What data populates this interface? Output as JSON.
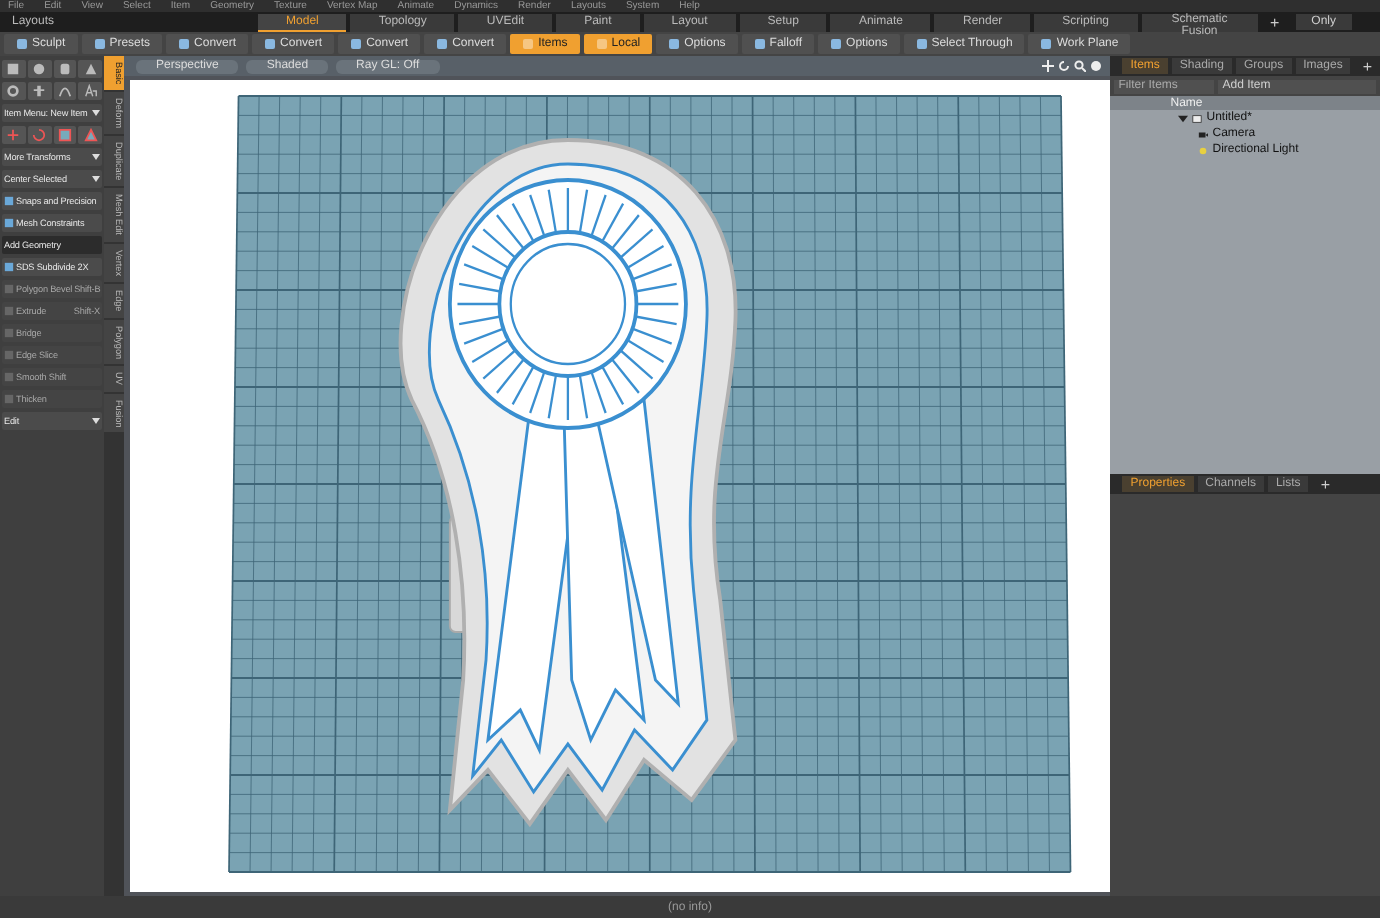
{
  "menu_bar": {
    "items": [
      "File",
      "Edit",
      "View",
      "Select",
      "Item",
      "Geometry",
      "Texture",
      "Vertex Map",
      "Animate",
      "Dynamics",
      "Render",
      "Layouts",
      "System",
      "Help"
    ]
  },
  "layout_bar": {
    "label": "Layouts",
    "tabs": [
      {
        "label": "Model",
        "selected": true
      },
      {
        "label": "Topology",
        "selected": false
      },
      {
        "label": "UVEdit",
        "selected": false
      },
      {
        "label": "Paint",
        "selected": false
      },
      {
        "label": "Layout",
        "selected": false
      },
      {
        "label": "Setup",
        "selected": false
      },
      {
        "label": "Animate",
        "selected": false
      },
      {
        "label": "Render",
        "selected": false
      },
      {
        "label": "Scripting",
        "selected": false
      },
      {
        "label": "Schematic Fusion",
        "selected": false
      }
    ],
    "add": "+",
    "only": "Only"
  },
  "toolbar": {
    "buttons": [
      {
        "label": "Sculpt",
        "selected": false
      },
      {
        "label": "Presets",
        "selected": false
      },
      {
        "label": "Convert",
        "selected": false
      },
      {
        "label": "Convert",
        "selected": false
      },
      {
        "label": "Convert",
        "selected": false
      },
      {
        "label": "Convert",
        "selected": false
      },
      {
        "label": "Items",
        "selected": true
      },
      {
        "label": "Local",
        "selected": true
      },
      {
        "label": "Options",
        "selected": false
      },
      {
        "label": "Falloff",
        "selected": false
      },
      {
        "label": "Options",
        "selected": false
      },
      {
        "label": "Select Through",
        "selected": false
      },
      {
        "label": "Work Plane",
        "selected": false
      }
    ]
  },
  "left_panel": {
    "items": [
      {
        "kind": "dropdown",
        "label": "Item Menu: New Item"
      },
      {
        "kind": "dropdown",
        "label": "More Transforms"
      },
      {
        "kind": "dropdown",
        "label": "Center Selected"
      },
      {
        "kind": "tool",
        "label": "Snaps and Precision",
        "disabled": false
      },
      {
        "kind": "tool",
        "label": "Mesh Constraints",
        "disabled": false
      },
      {
        "kind": "header",
        "label": "Add Geometry"
      },
      {
        "kind": "tool",
        "label": "SDS Subdivide 2X",
        "disabled": false
      },
      {
        "kind": "tool",
        "label": "Polygon Bevel",
        "shortcut": "Shift-B",
        "disabled": true
      },
      {
        "kind": "tool",
        "label": "Extrude",
        "shortcut": "Shift-X",
        "disabled": true
      },
      {
        "kind": "tool",
        "label": "Bridge",
        "disabled": true
      },
      {
        "kind": "tool",
        "label": "Edge Slice",
        "disabled": true
      },
      {
        "kind": "tool",
        "label": "Smooth Shift",
        "disabled": true
      },
      {
        "kind": "tool",
        "label": "Thicken",
        "disabled": true
      },
      {
        "kind": "dropdown",
        "label": "Edit"
      }
    ],
    "side_tabs": [
      {
        "label": "Basic",
        "selected": true
      },
      {
        "label": "Deform",
        "selected": false
      },
      {
        "label": "Duplicate",
        "selected": false
      },
      {
        "label": "Mesh Edit",
        "selected": false
      },
      {
        "label": "Vertex",
        "selected": false
      },
      {
        "label": "Edge",
        "selected": false
      },
      {
        "label": "Polygon",
        "selected": false
      },
      {
        "label": "UV",
        "selected": false
      },
      {
        "label": "Fusion",
        "selected": false
      }
    ]
  },
  "viewport": {
    "view_buttons": [
      "Perspective",
      "Shaded",
      "Ray GL: Off"
    ]
  },
  "item_panel": {
    "tabs": [
      {
        "label": "Items",
        "selected": true
      },
      {
        "label": "Shading",
        "selected": false
      },
      {
        "label": "Groups",
        "selected": false
      },
      {
        "label": "Images",
        "selected": false
      }
    ],
    "add": "+",
    "filter": {
      "placeholder": "Filter Items"
    },
    "add_item": "Add Item",
    "columns": [
      "Name"
    ],
    "tree": [
      {
        "label": "Untitled*",
        "kind": "scene",
        "expanded": true,
        "children": [
          {
            "label": "Camera",
            "kind": "camera"
          },
          {
            "label": "Directional Light",
            "kind": "light"
          }
        ]
      }
    ]
  },
  "properties_panel": {
    "tabs": [
      {
        "label": "Properties",
        "selected": true
      },
      {
        "label": "Channels",
        "selected": false
      },
      {
        "label": "Lists",
        "selected": false
      }
    ],
    "add": "+"
  },
  "status_bar": {
    "text": "(no info)"
  }
}
